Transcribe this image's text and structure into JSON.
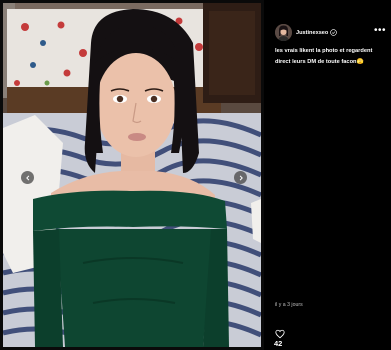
{
  "post": {
    "author": "Justinexseo",
    "caption": "les vrais likent la photo et regardent direct leurs DM de toute facon🫣",
    "time": "il y a 3 jours",
    "likes": "42"
  },
  "icons": {
    "more": "more-options-icon",
    "verified": "verified-badge-icon",
    "like": "heart-icon",
    "prev": "chevron-left-icon",
    "next": "chevron-right-icon"
  },
  "colors": {
    "background": "#000000",
    "text": "#ffffff",
    "muted": "#bdbdbd"
  }
}
